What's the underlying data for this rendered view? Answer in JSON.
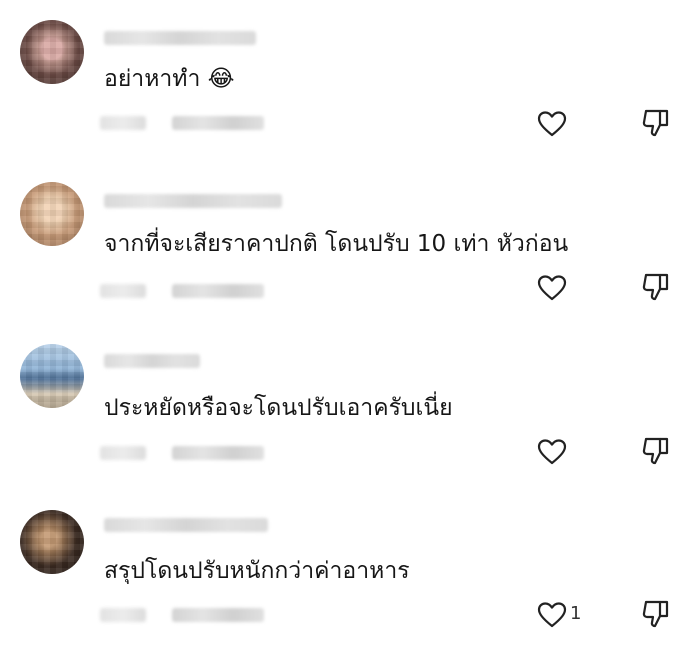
{
  "comments": [
    {
      "text": "อย่าหาทำ 😂",
      "username_blurred": true,
      "meta_blurred": true,
      "like_icon": "heart-outline-icon",
      "dislike_icon": "thumbs-down-outline-icon",
      "avatar_colors": [
        "#6b4a44",
        "#b98f86",
        "#3d2a27"
      ]
    },
    {
      "text": "จากที่จะเสียราคาปกติ โดนปรับ 10 เท่า หัวก่อน",
      "username_blurred": true,
      "meta_blurred": true,
      "like_icon": "heart-outline-icon",
      "dislike_icon": "thumbs-down-outline-icon",
      "avatar_colors": [
        "#c79a77",
        "#e8c8a8",
        "#8a6448"
      ]
    },
    {
      "text": "ประหยัดหรือจะโดนปรับเอาครับเนี่ย",
      "username_blurred": true,
      "meta_blurred": true,
      "like_icon": "heart-outline-icon",
      "dislike_icon": "thumbs-down-outline-icon",
      "avatar_colors": [
        "#8fb3d6",
        "#4d6f96",
        "#d7c9b3"
      ]
    },
    {
      "text": "สรุปโดนปรับหนักกว่าค่าอาหาร",
      "username_blurred": true,
      "meta_blurred": true,
      "like_icon": "heart-outline-icon",
      "like_count": "1",
      "dislike_icon": "thumbs-down-outline-icon",
      "avatar_colors": [
        "#3c2b22",
        "#a07a58",
        "#1f1712"
      ]
    }
  ],
  "colors": {
    "text": "#161616",
    "icon_stroke": "#222222",
    "blur_placeholder": "#dcdcdc",
    "background": "#ffffff"
  }
}
